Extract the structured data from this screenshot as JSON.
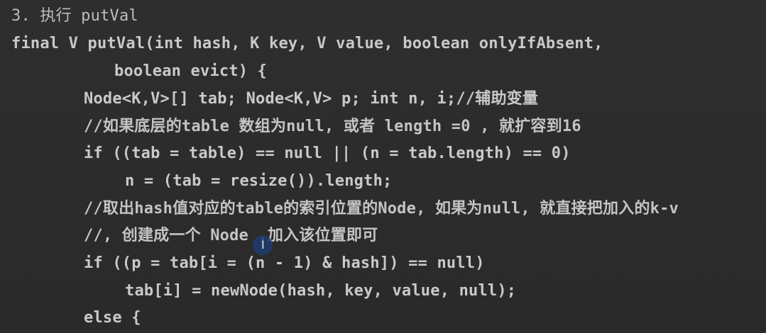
{
  "editor": {
    "lines": [
      "3. 执行 putVal",
      "final V putVal(int hash, K key, V value, boolean onlyIfAbsent,",
      "boolean evict) {",
      "Node<K,V>[] tab; Node<K,V> p; int n, i;//辅助变量",
      "//如果底层的table 数组为null, 或者 length =0 , 就扩容到16",
      "if ((tab = table) == null || (n = tab.length) == 0)",
      "n = (tab = resize()).length;",
      "//取出hash值对应的table的索引位置的Node, 如果为null, 就直接把加入的k-v",
      "//, 创建成一个 Node ,加入该位置即可",
      "if ((p = tab[i = (n - 1) & hash]) == null)",
      "tab[i] = newNode(hash, key, value, null);",
      "else {"
    ],
    "cursor_icon": "text-cursor-icon",
    "cursor_glyph": "I",
    "colors": {
      "background": "#2b2b2b",
      "text": "#c9c9c9",
      "cursor_highlight": "#1e3c6e"
    }
  }
}
